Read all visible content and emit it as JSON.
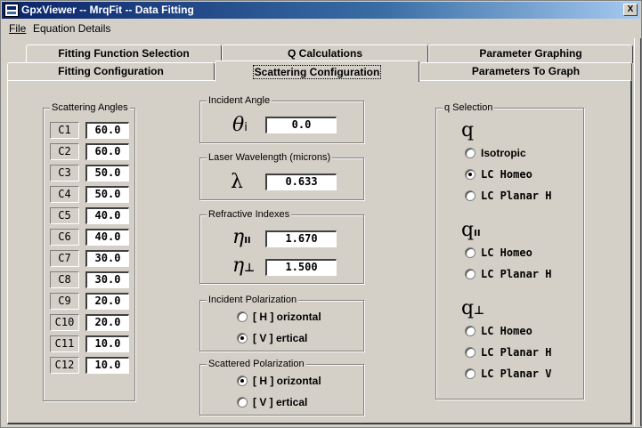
{
  "window": {
    "title": "GpxViewer -- MrqFit -- Data Fitting",
    "close_label": "X"
  },
  "menu": {
    "file": "File",
    "equation_details": "Equation Details"
  },
  "tabs": {
    "back_row": [
      "Fitting Function Selection",
      "Q  Calculations",
      "Parameter Graphing"
    ],
    "front_row": [
      "Fitting Configuration",
      "Scattering Configuration",
      "Parameters To Graph"
    ],
    "selected": "Scattering Configuration"
  },
  "scattering_angles": {
    "title": "Scattering Angles",
    "rows": [
      {
        "label": "C1",
        "value": "60.0"
      },
      {
        "label": "C2",
        "value": "60.0"
      },
      {
        "label": "C3",
        "value": "50.0"
      },
      {
        "label": "C4",
        "value": "50.0"
      },
      {
        "label": "C5",
        "value": "40.0"
      },
      {
        "label": "C6",
        "value": "40.0"
      },
      {
        "label": "C7",
        "value": "30.0"
      },
      {
        "label": "C8",
        "value": "30.0"
      },
      {
        "label": "C9",
        "value": "20.0"
      },
      {
        "label": "C10",
        "value": "20.0"
      },
      {
        "label": "C11",
        "value": "10.0"
      },
      {
        "label": "C12",
        "value": "10.0"
      }
    ]
  },
  "incident_angle": {
    "title": "Incident Angle",
    "symbol": "θ",
    "subscript": "i",
    "value": "0.0"
  },
  "laser_wavelength": {
    "title": "Laser Wavelength  (microns)",
    "symbol": "λ",
    "value": "0.633"
  },
  "refractive_indexes": {
    "title": "Refractive Indexes",
    "symbol": "η",
    "parallel_sub": "II",
    "perp_sub": "⊥",
    "parallel_value": "1.670",
    "perp_value": "1.500"
  },
  "incident_polarization": {
    "title": "Incident Polarization",
    "options": [
      "[ H ] orizontal",
      "[ V ] ertical"
    ],
    "selected": "[ V ] ertical"
  },
  "scattered_polarization": {
    "title": "Scattered Polarization",
    "options": [
      "[ H ] orizontal",
      "[ V ] ertical"
    ],
    "selected": "[ H ] orizontal"
  },
  "q_selection": {
    "title": "q  Selection",
    "q_symbol": "q",
    "parallel_sub": "II",
    "perp_sub": "⊥",
    "q_options": [
      "Isotropic",
      "LC  Homeo",
      "LC  Planar  H"
    ],
    "q_parallel_options": [
      "LC  Homeo",
      "LC  Planar  H"
    ],
    "q_perp_options": [
      "LC  Homeo",
      "LC  Planar  H",
      "LC  Planar  V"
    ],
    "selected": "q:LC  Homeo"
  }
}
